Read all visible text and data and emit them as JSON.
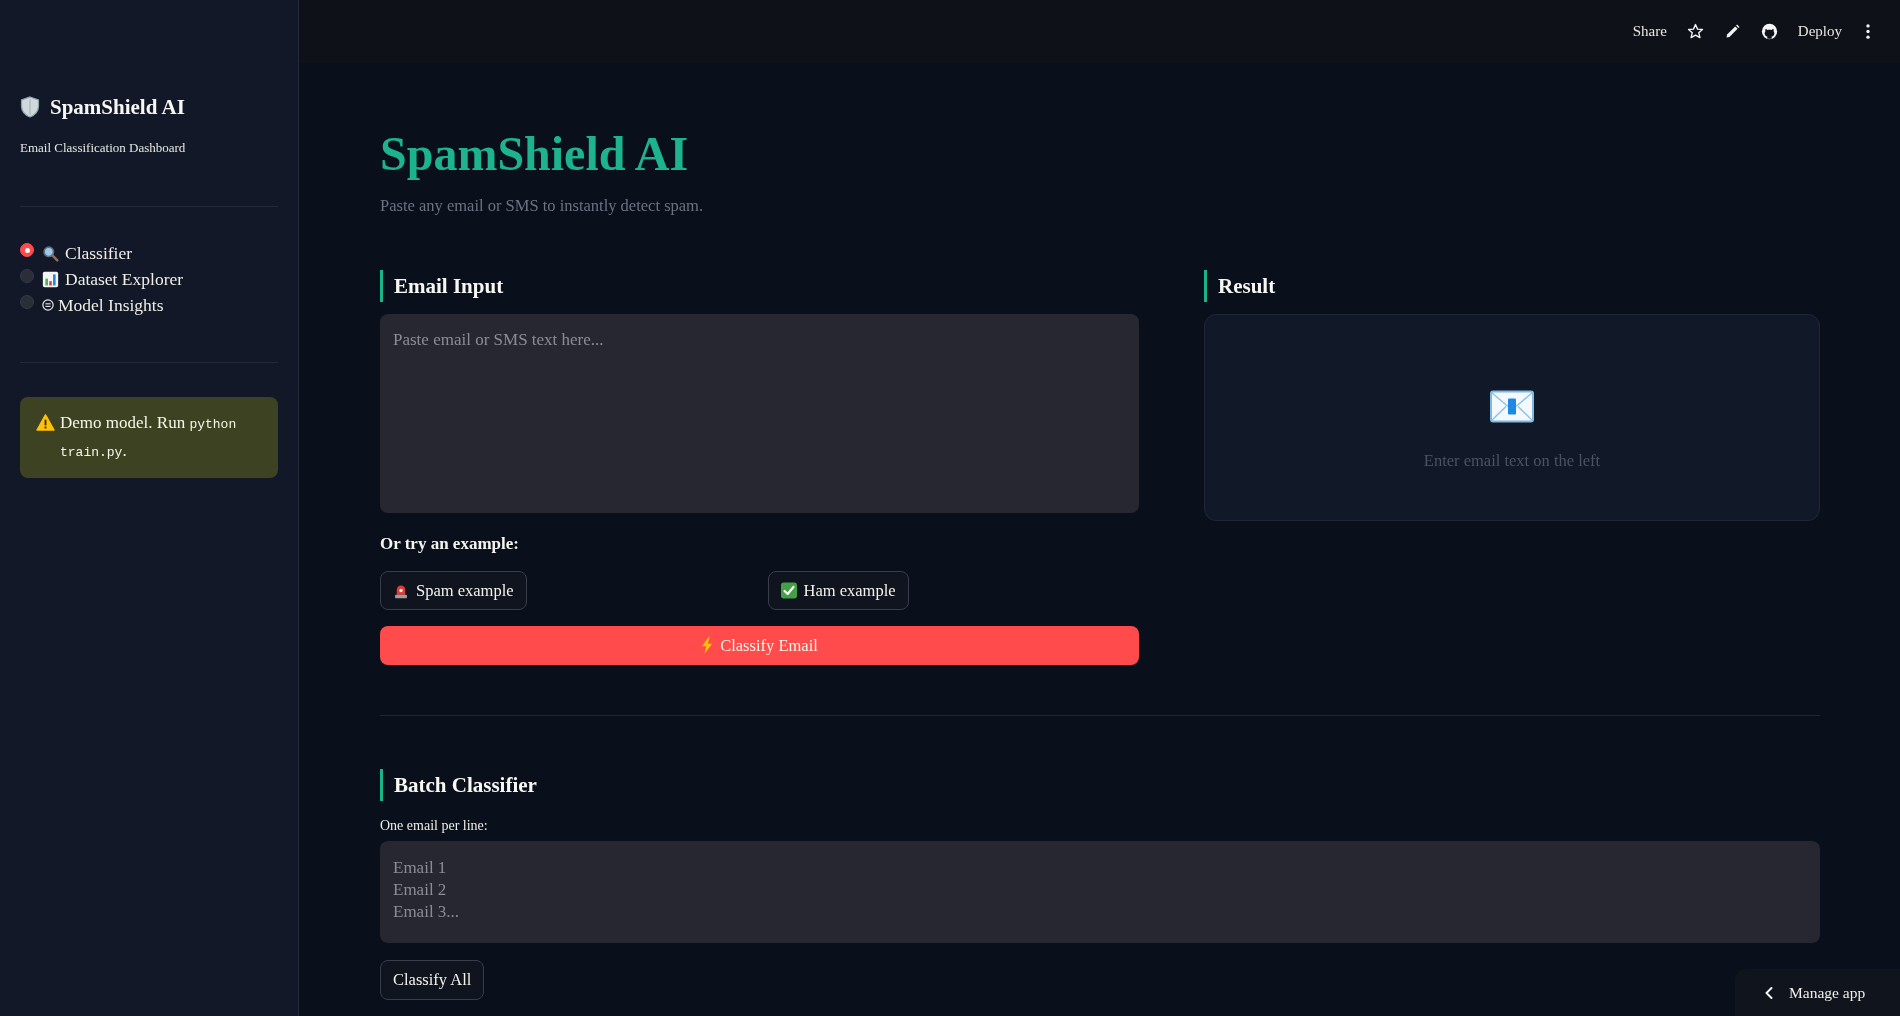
{
  "topbar": {
    "share_label": "Share",
    "deploy_label": "Deploy"
  },
  "sidebar": {
    "title": "SpamShield AI",
    "subtitle": "Email Classification Dashboard",
    "nav": [
      {
        "label": "Classifier",
        "selected": true
      },
      {
        "label": "Dataset Explorer",
        "selected": false
      },
      {
        "label": "Model Insights",
        "selected": false
      }
    ],
    "notice": {
      "parts": [
        {
          "kind": "text",
          "text": "Demo model. Run "
        },
        {
          "kind": "code",
          "text": "python train.py"
        },
        {
          "kind": "text",
          "text": "."
        }
      ]
    }
  },
  "main": {
    "title": "SpamShield AI",
    "subtitle": "Paste any email or SMS to instantly detect spam.",
    "email_input": {
      "heading": "Email Input",
      "placeholder": "Paste email or SMS text here...",
      "examples_label": "Or try an example:",
      "examples": [
        {
          "label": "Spam example"
        },
        {
          "label": "Ham example"
        }
      ],
      "classify_button": "Classify Email"
    },
    "result": {
      "heading": "Result",
      "message": "Enter email text on the left"
    },
    "batch": {
      "heading": "Batch Classifier",
      "label": "One email per line:",
      "placeholder": "Email 1\nEmail 2\nEmail 3...",
      "button": "Classify All"
    }
  },
  "manage_app": {
    "label": "Manage app"
  }
}
